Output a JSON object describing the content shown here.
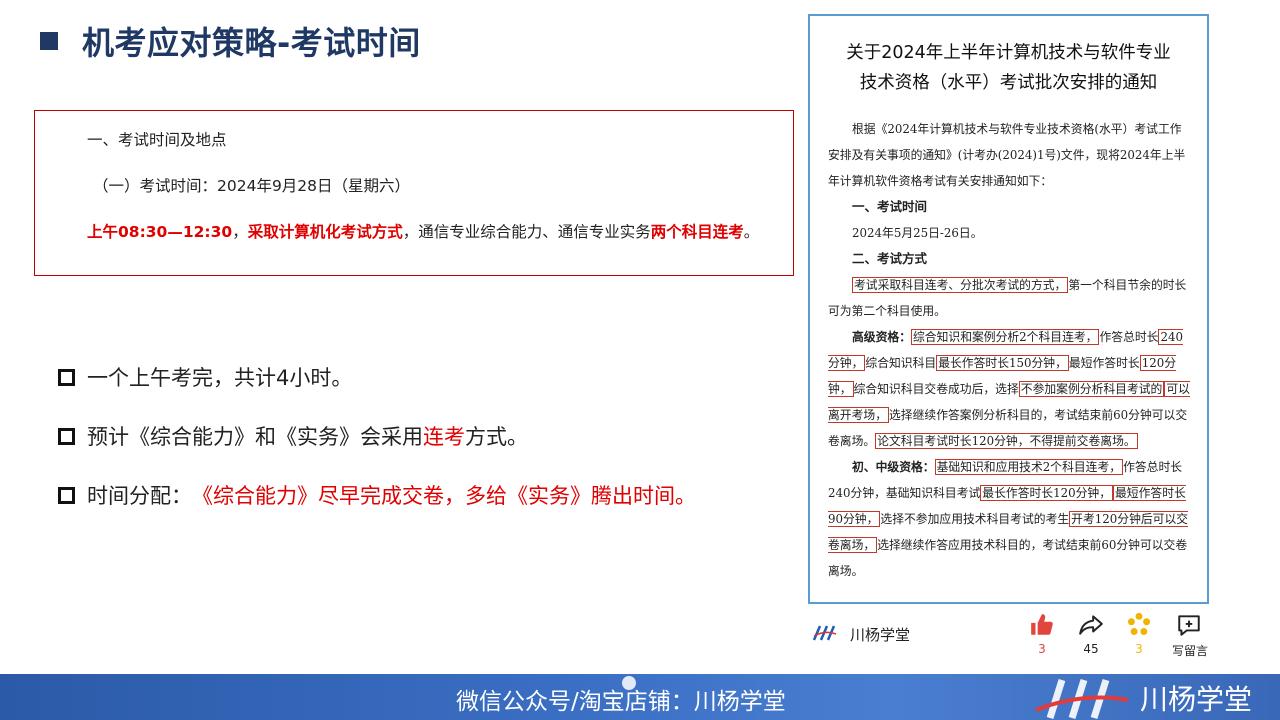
{
  "slide": {
    "title": "机考应对策略-考试时间"
  },
  "notice": {
    "line1": "一、考试时间及地点",
    "line2": "（一）考试时间：2024年9月28日（星期六）",
    "line3_part1": "上午08:30—12:30",
    "line3_part2": "，",
    "line3_part3": "采取计算机化考试方式",
    "line3_part4": "，通信专业综合能力、通信专业实务",
    "line3_part5": "两个科目连考",
    "line3_part6": "。"
  },
  "bullets": [
    {
      "text": "一个上午考完，共计4小时。"
    },
    {
      "text_before": "预计《综合能力》和《实务》会采用",
      "text_red": "连考",
      "text_after": "方式。"
    },
    {
      "text_before": "时间分配：",
      "text_red": "《综合能力》尽早完成交卷，多给《实务》腾出时间。"
    }
  ],
  "doc": {
    "title_line1": "关于2024年上半年计算机技术与软件专业",
    "title_line2": "技术资格（水平）考试批次安排的通知",
    "intro": "根据《2024年计算机技术与软件专业技术资格(水平）考试工作安排及有关事项的通知》(计考办(2024)1号)文件，现将2024年上半年计算机软件资格考试有关安排通知如下：",
    "sec1": "一、考试时间",
    "date": "2024年5月25日-26日。",
    "sec2": "二、考试方式",
    "p1_hl": "考试采取科目连考、分批次考试的方式，",
    "p1_rest": "第一个科目节余的时长可为第二个科目使用。",
    "p2_label": "高级资格：",
    "p2_hl1": "综合知识和案例分析2个科目连考，",
    "p2_t1": "作答总时长",
    "p2_hl2": "240分钟，",
    "p2_t2": "综合知识科目",
    "p2_hl3": "最长作答时长150分钟，",
    "p2_t3": "最短作答时长",
    "p2_hl4": "120分钟，",
    "p2_t4": "综合知识科目交卷成功后，选择",
    "p2_hl5": "不参加案例分析科目考试的",
    "p2_hl6": "可以离开考场，",
    "p2_t5": "选择继续作答案例分析科目的，考试结束前60分钟可以交卷离场。",
    "p2_hl7": "论文科目考试时长120分钟，不得提前交卷离场。",
    "p3_label": "初、中级资格：",
    "p3_hl1": "基础知识和应用技术2个科目连考，",
    "p3_t1": "作答总时长240分钟，基础知识科目考试",
    "p3_hl2": "最长作答时长120分钟，",
    "p3_hl3": "最短作答时长90分钟，",
    "p3_t2": "选择不参加应用技术科目考试的考生",
    "p3_hl4": "开考120分钟后可以交卷离场，",
    "p3_t3": "选择继续作答应用技术科目的，考试结束前60分钟可以交卷离场。"
  },
  "social": {
    "account": "川杨学堂",
    "likes": "3",
    "shares": "45",
    "favorites": "3",
    "comment_label": "写留言"
  },
  "footer": {
    "text": "微信公众号/淘宝店铺：川杨学堂",
    "brand": "川杨学堂"
  },
  "colors": {
    "title": "#1f3864",
    "accent_red": "#e00000",
    "doc_border": "#5b9bd5",
    "footer_blue": "#3b6fc4"
  }
}
